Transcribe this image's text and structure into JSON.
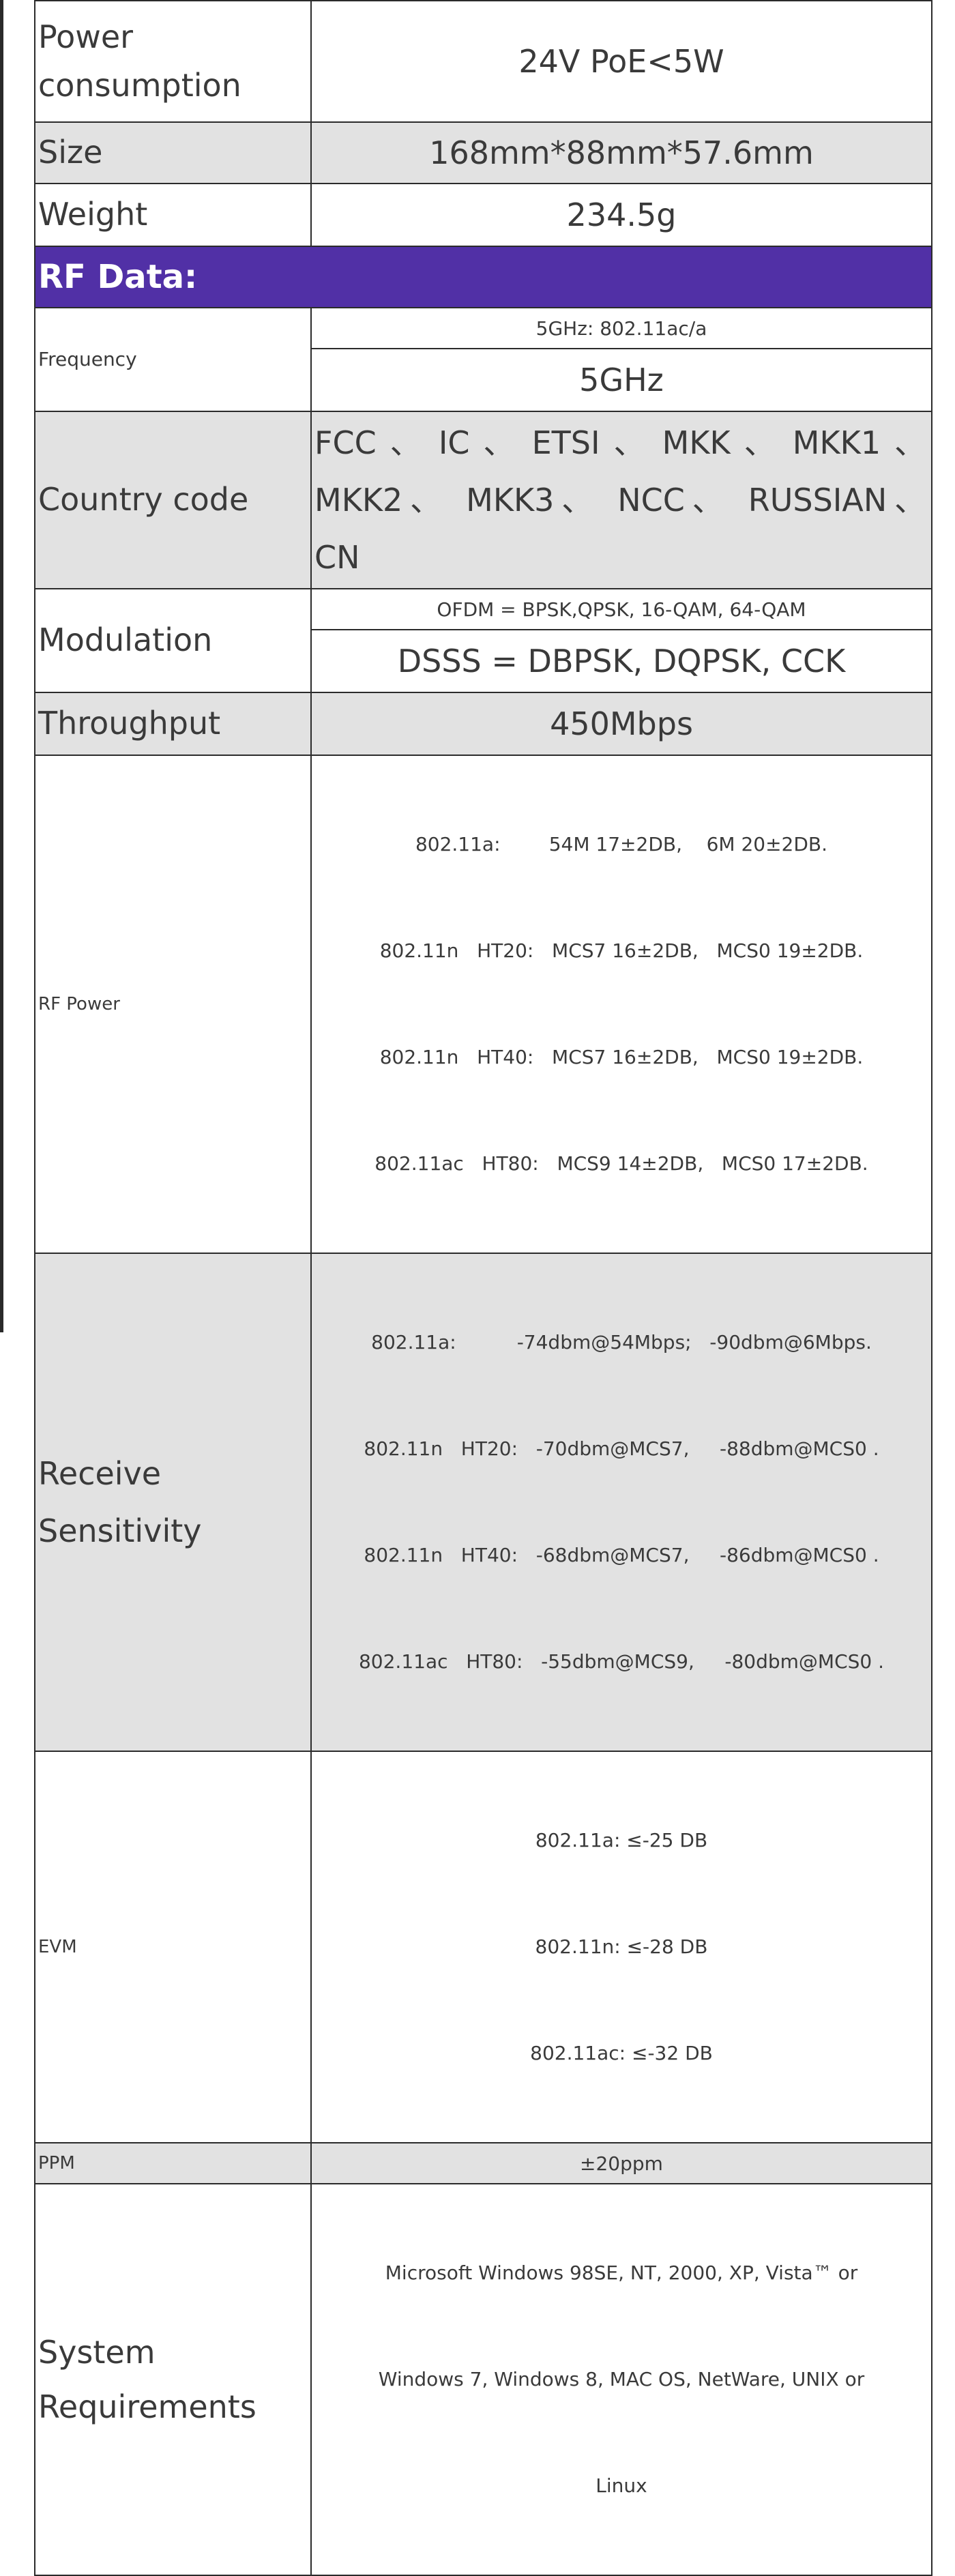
{
  "rows": {
    "power": {
      "label_line1": "Power",
      "label_line2": "consumption",
      "value": "24V PoE<5W"
    },
    "size": {
      "label": "Size",
      "value": "168mm*88mm*57.6mm"
    },
    "weight": {
      "label": "Weight",
      "value": "234.5g"
    },
    "rf_section": {
      "title": "RF Data:"
    },
    "frequency": {
      "label": "Frequency",
      "value1": "5GHz: 802.11ac/a",
      "value2": "5GHz"
    },
    "country": {
      "label": "Country code",
      "line1": "FCC 、 IC 、 ETSI 、 MKK 、 MKK1 、",
      "line2": "MKK2、 MKK3、 NCC、 RUSSIAN、",
      "line3": "CN"
    },
    "modulation": {
      "label": "Modulation",
      "value1": "OFDM = BPSK,QPSK, 16-QAM, 64-QAM",
      "value2": "DSSS = DBPSK, DQPSK, CCK"
    },
    "throughput": {
      "label": "Throughput",
      "value": "450Mbps"
    },
    "rf_power": {
      "label": "RF Power",
      "lines": [
        "802.11a:        54M 17±2DB,    6M 20±2DB.",
        "802.11n   HT20:   MCS7 16±2DB,   MCS0 19±2DB.",
        "802.11n   HT40:   MCS7 16±2DB,   MCS0 19±2DB.",
        "802.11ac   HT80:   MCS9 14±2DB,   MCS0 17±2DB."
      ]
    },
    "sensitivity": {
      "label_line1": "Receive",
      "label_line2": "Sensitivity",
      "lines": [
        "802.11a:          -74dbm@54Mbps;   -90dbm@6Mbps.",
        "802.11n   HT20:   -70dbm@MCS7,     -88dbm@MCS0 .",
        "802.11n   HT40:   -68dbm@MCS7,     -86dbm@MCS0 .",
        "802.11ac   HT80:   -55dbm@MCS9,     -80dbm@MCS0 ."
      ]
    },
    "evm": {
      "label": "EVM",
      "lines": [
        "802.11a: ≤-25 DB",
        "802.11n: ≤-28 DB",
        "802.11ac: ≤-32 DB"
      ]
    },
    "ppm": {
      "label": "PPM",
      "value": "±20ppm"
    },
    "system": {
      "label_line1": "System",
      "label_line2": "Requirements",
      "lines": [
        "Microsoft Windows 98SE, NT, 2000, XP, Vista™ or",
        "Windows 7, Windows 8, MAC OS, NetWare, UNIX or",
        "Linux"
      ]
    }
  }
}
